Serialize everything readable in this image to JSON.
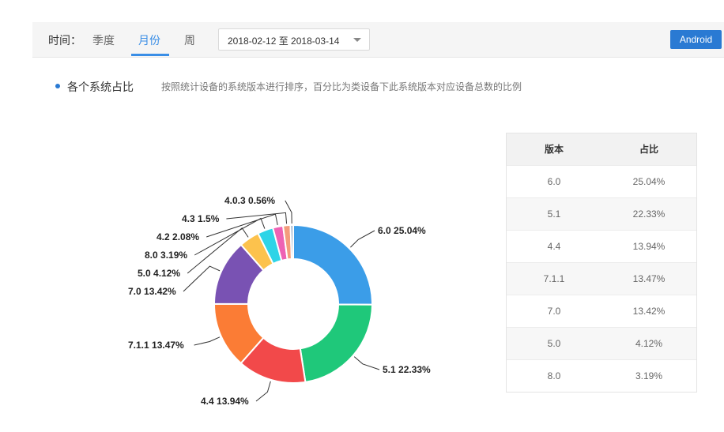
{
  "filter_bar": {
    "time_label": "时间：",
    "tabs": [
      "季度",
      "月份",
      "周"
    ],
    "active_tab": "月份",
    "date_range": "2018-02-12 至 2018-03-14",
    "platform_button": "Android"
  },
  "section": {
    "title": "各个系统占比",
    "description": "按照统计设备的系统版本进行排序，百分比为类设备下此系统版本对应设备总数的比例"
  },
  "table": {
    "headers": [
      "版本",
      "占比"
    ],
    "rows": [
      [
        "6.0",
        "25.04%"
      ],
      [
        "5.1",
        "22.33%"
      ],
      [
        "4.4",
        "13.94%"
      ],
      [
        "7.1.1",
        "13.47%"
      ],
      [
        "7.0",
        "13.42%"
      ],
      [
        "5.0",
        "4.12%"
      ],
      [
        "8.0",
        "3.19%"
      ]
    ]
  },
  "chart_data": {
    "type": "pie",
    "donut": true,
    "title": "",
    "slices": [
      {
        "label": "6.0",
        "value": 25.04,
        "display": "6.0 25.04%",
        "color": "#3b9de8"
      },
      {
        "label": "5.1",
        "value": 22.33,
        "display": "5.1 22.33%",
        "color": "#1fc87a"
      },
      {
        "label": "4.4",
        "value": 13.94,
        "display": "4.4 13.94%",
        "color": "#f2494a"
      },
      {
        "label": "7.1.1",
        "value": 13.47,
        "display": "7.1.1 13.47%",
        "color": "#fb7c35"
      },
      {
        "label": "7.0",
        "value": 13.42,
        "display": "7.0 13.42%",
        "color": "#7952b3"
      },
      {
        "label": "5.0",
        "value": 4.12,
        "display": "5.0 4.12%",
        "color": "#fcc24d"
      },
      {
        "label": "8.0",
        "value": 3.19,
        "display": "8.0 3.19%",
        "color": "#2ed4e7"
      },
      {
        "label": "4.2",
        "value": 2.08,
        "display": "4.2 2.08%",
        "color": "#ee62b4"
      },
      {
        "label": "4.3",
        "value": 1.5,
        "display": "4.3 1.5%",
        "color": "#f49c7c"
      },
      {
        "label": "4.0.3",
        "value": 0.56,
        "display": "4.0.3 0.56%",
        "color": "#8da7c6"
      }
    ]
  }
}
